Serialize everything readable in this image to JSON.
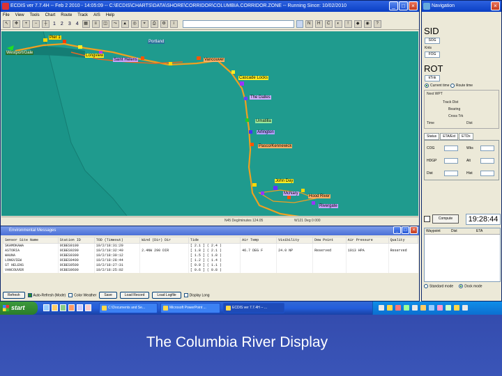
{
  "main_window": {
    "title": "ECDIS ver 7.7.4H -- Feb 2 2010 - 14:05:09 -- C:\\ECDIS\\CHARTS\\DATA\\SHORE\\CORRIDOR\\COLUMBIA.CORRIDOR.ZONE -- Running Since: 10/02/2010",
    "menu": [
      "File",
      "View",
      "Tools",
      "Chart",
      "Route",
      "Track",
      "AIS",
      "Help"
    ],
    "toolbar_numbers": [
      "1",
      "2",
      "3",
      "4"
    ],
    "status_left": "",
    "status_coords": "N45 Deg/minutes 124.05",
    "status_coords2": "W121 Deg 0 000"
  },
  "map": {
    "labels": [
      "Westport/Gale",
      "Pier 1",
      "Longview",
      "Portland",
      "Saint Helens",
      "Vancouver",
      "Cascade Locks",
      "The Dalles",
      "Umatilla",
      "Arlington",
      "Pasco/Kennewick",
      "John Day",
      "McNary",
      "Hood River",
      "Rivergate"
    ]
  },
  "env_panel": {
    "title": "Environmental Messages",
    "columns": [
      "Sensor Site Name",
      "Station ID",
      "TOD (Timeout)",
      "Wind (Dir) Dir",
      "Tide",
      "Air Temp",
      "Visibility",
      "Dew Point",
      "Air Pressure",
      "Quality"
    ],
    "rows": [
      [
        "SKAMOKAWA",
        "0CBES9100",
        "10/2/18:31:20",
        "",
        "[ 2.1 ] ( 2.4 )",
        "",
        "",
        "",
        "",
        ""
      ],
      [
        "ASTORIA",
        "0CBES9200",
        "10/2/18:32:40",
        "2.4NW 290 DIR",
        "[ 1.8 ] ( 2.1 )",
        "46.7 DEG F",
        "24.0 NP",
        "Reserved",
        "1013 HPA",
        "Reserved"
      ],
      [
        "WAUNA",
        "0CBES9300",
        "10/2/18:30:12",
        "",
        "[ 1.5 ] ( 1.8 )",
        "",
        "",
        "",
        "",
        ""
      ],
      [
        "LONGVIEW",
        "0CBES9400",
        "10/2/18:28:44",
        "",
        "[ 1.2 ] ( 1.4 )",
        "",
        "",
        "",
        "",
        ""
      ],
      [
        "ST HELENS",
        "0CBES9500",
        "10/2/18:27:31",
        "",
        "[ 0.9 ] ( 1.1 )",
        "",
        "",
        "",
        "",
        ""
      ],
      [
        "VANCOUVER",
        "0CBES9600",
        "10/2/18:25:02",
        "",
        "[ 0.6 ] ( 0.8 )",
        "",
        "",
        "",
        "",
        ""
      ]
    ],
    "buttons": [
      "Refresh",
      "Auto-Refresh (Mode)",
      "Color Weather",
      "Save",
      "Load Record",
      "Load Logfile",
      "Display Long"
    ]
  },
  "nav_window": {
    "title": "Navigation",
    "sid_label": "SID",
    "sid_buttons": [
      "SOG",
      "Knts",
      "FOG"
    ],
    "rot_label": "ROT",
    "rot_button": "kTnk",
    "options": [
      "Current time",
      "Route time"
    ],
    "box_labels": [
      "Next WPT",
      "Track Dist",
      "Bearing",
      "Cross Trk",
      "Time",
      "Dist"
    ],
    "tabs": [
      "Status",
      "ETA/Est",
      "ETDx"
    ],
    "grid_labels": [
      "COG",
      "Wks",
      "HDGP",
      "Alt",
      "Dist",
      "Hist"
    ],
    "clock_button": "Compute",
    "clock": "19:28:44",
    "wp_columns": [
      "Waypoint",
      "Dist",
      "ETA"
    ],
    "radio_labels": [
      "Standard mode",
      "Dock mode"
    ]
  },
  "taskbar": {
    "start": "start",
    "tasks": [
      "C:\\Documents and Se...",
      "Microsoft PowerPoint ...",
      "ECDIS ver 7.7.4H -- ..."
    ],
    "clock": ""
  },
  "caption": "The Columbia River Display",
  "colors": {
    "water": "#1a9488",
    "land": "#1a9488",
    "channel": "#f0a020",
    "xp_blue": "#0a3fc4",
    "slide_bg": "#2b3f9f"
  }
}
